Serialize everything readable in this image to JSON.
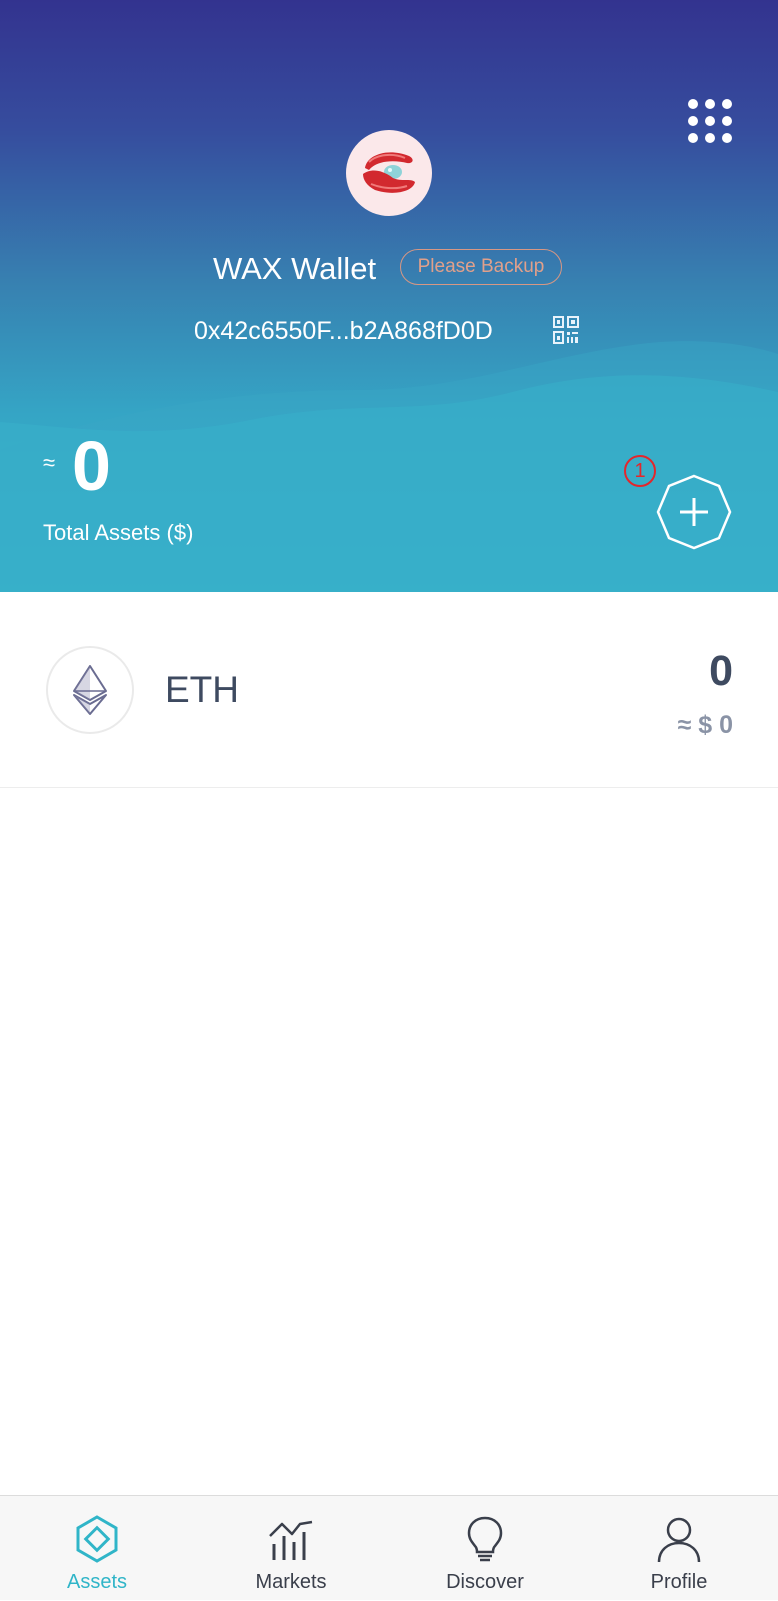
{
  "header": {
    "wallet_name": "WAX Wallet",
    "backup_label": "Please Backup",
    "address": "0x42c6550F...b2A868fD0D",
    "approx_symbol": "≈",
    "total_value": "0",
    "total_label": "Total Assets ($)",
    "notification_count": "1"
  },
  "assets": [
    {
      "symbol": "ETH",
      "amount": "0",
      "fiat": "≈ $ 0",
      "icon": "ethereum-icon"
    }
  ],
  "tabbar": {
    "tabs": [
      {
        "label": "Assets",
        "icon": "assets-icon",
        "active": true
      },
      {
        "label": "Markets",
        "icon": "markets-icon",
        "active": false
      },
      {
        "label": "Discover",
        "icon": "discover-icon",
        "active": false
      },
      {
        "label": "Profile",
        "icon": "profile-icon",
        "active": false
      }
    ]
  },
  "colors": {
    "accent": "#30b5c8",
    "header_top": "#33338f",
    "header_bottom": "#36b6cb",
    "backup_border": "#d79784",
    "badge": "#e3262c",
    "text_dark": "#3e4a60"
  }
}
